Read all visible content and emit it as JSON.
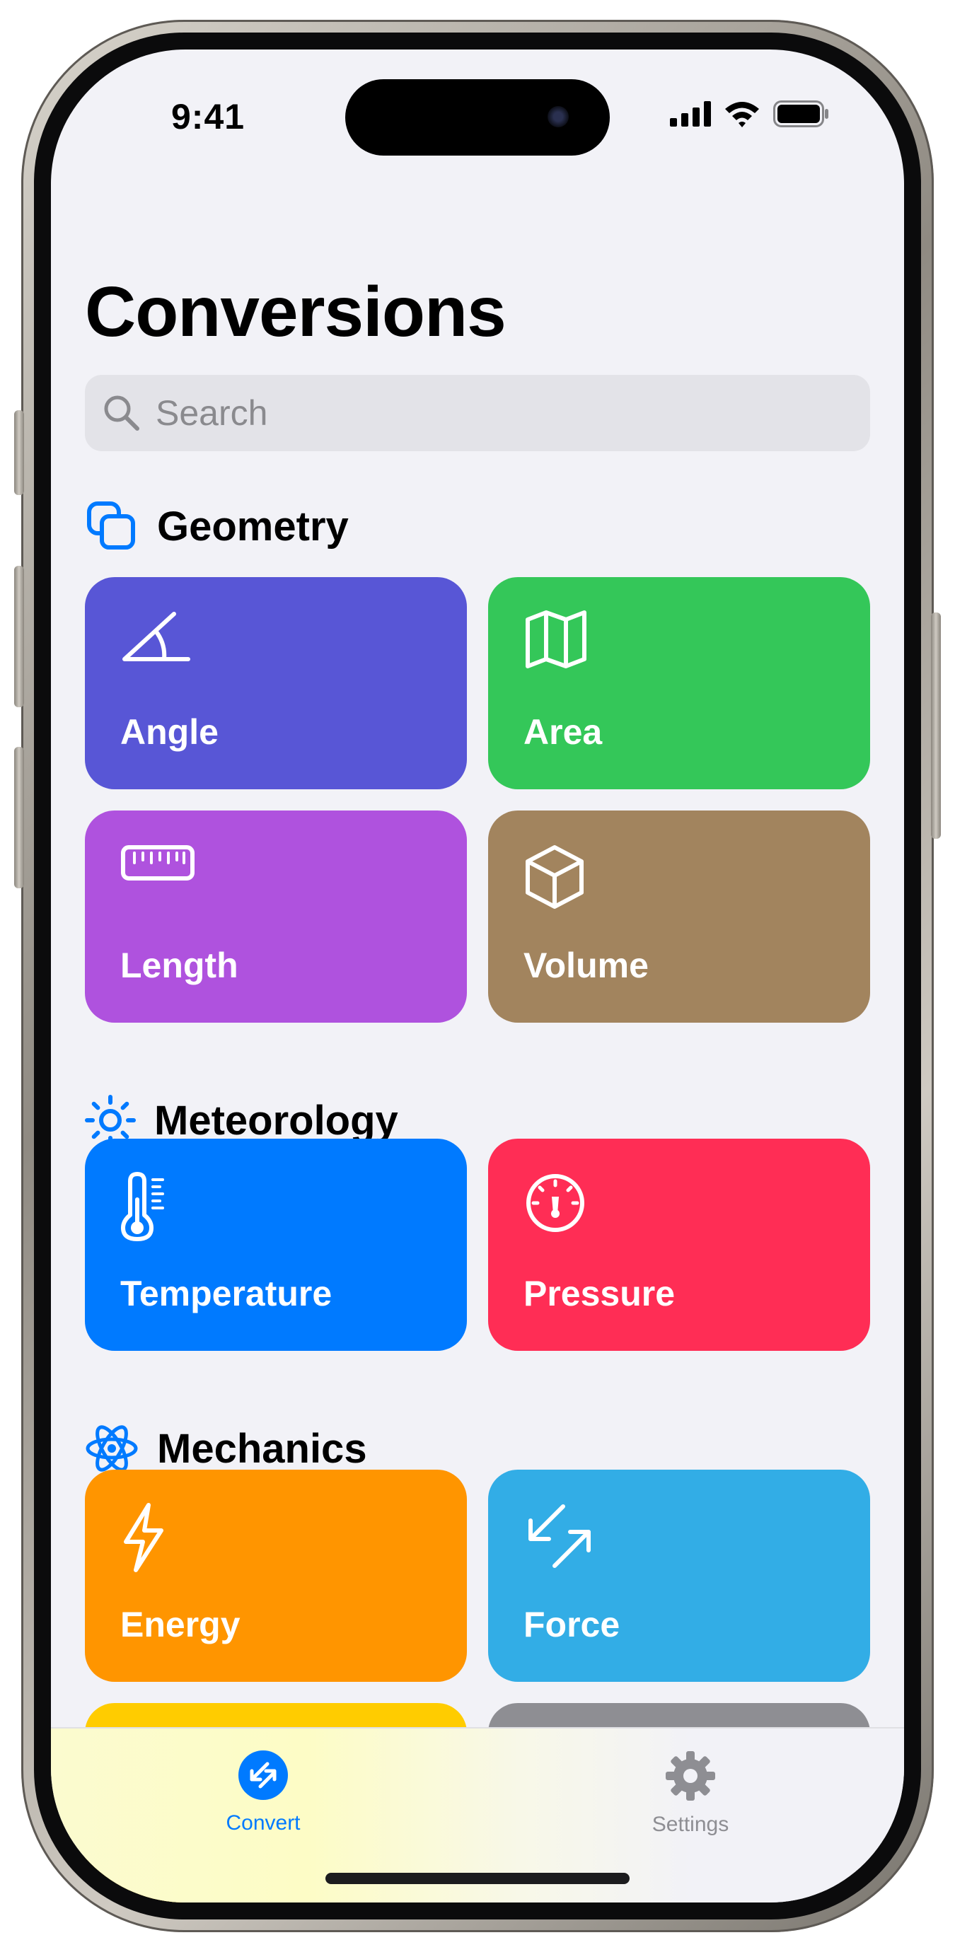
{
  "status_bar": {
    "time": "9:41",
    "icons": [
      "signal-icon",
      "wifi-icon",
      "battery-icon"
    ]
  },
  "page": {
    "title": "Conversions"
  },
  "search": {
    "placeholder": "Search",
    "value": ""
  },
  "sections": [
    {
      "id": "geometry",
      "label": "Geometry",
      "icon": "squares-icon",
      "items": [
        {
          "label": "Angle",
          "icon": "angle-icon",
          "color": "#5856d6"
        },
        {
          "label": "Area",
          "icon": "map-icon",
          "color": "#34c759"
        },
        {
          "label": "Length",
          "icon": "ruler-icon",
          "color": "#af52de"
        },
        {
          "label": "Volume",
          "icon": "cube-icon",
          "color": "#a2845e"
        }
      ]
    },
    {
      "id": "meteorology",
      "label": "Meteorology",
      "icon": "sun-icon",
      "items": [
        {
          "label": "Temperature",
          "icon": "thermometer-icon",
          "color": "#007aff"
        },
        {
          "label": "Pressure",
          "icon": "gauge-icon",
          "color": "#ff2d55"
        }
      ]
    },
    {
      "id": "mechanics",
      "label": "Mechanics",
      "icon": "atom-icon",
      "items": [
        {
          "label": "Energy",
          "icon": "bolt-icon",
          "color": "#ff9500"
        },
        {
          "label": "Force",
          "icon": "arrows-diagonal-icon",
          "color": "#32ade6"
        },
        {
          "label": "",
          "icon": "",
          "color": "#ffcc00"
        },
        {
          "label": "",
          "icon": "",
          "color": "#8e8e93"
        }
      ]
    }
  ],
  "tab_bar": {
    "tabs": [
      {
        "label": "Convert",
        "icon": "convert-icon",
        "selected": true,
        "color": "#007aff"
      },
      {
        "label": "Settings",
        "icon": "gear-icon",
        "selected": false,
        "color": "#8e8e93"
      }
    ]
  },
  "colors": {
    "accent": "#007aff",
    "background": "#f2f2f7",
    "search_fill": "#e3e3e8"
  }
}
